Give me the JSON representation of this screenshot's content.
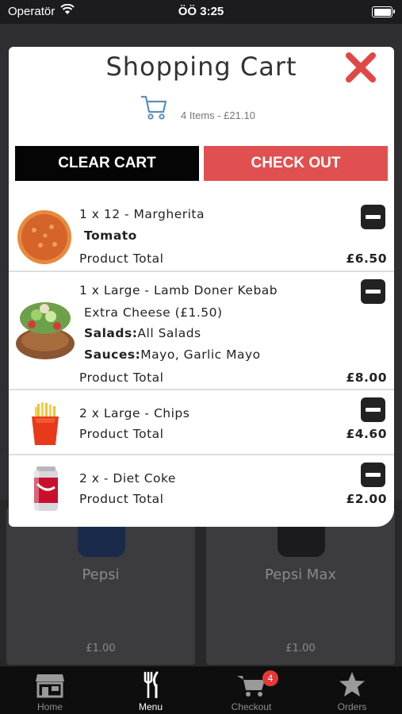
{
  "status_bar": {
    "carrier": "Operatör",
    "time": "ÖÖ 3:25"
  },
  "background_menu": {
    "products": [
      {
        "name": "Pepsi",
        "price": "£1.00"
      },
      {
        "name": "Pepsi Max",
        "price": "£1.00"
      }
    ]
  },
  "cart": {
    "title": "Shopping Cart",
    "summary": "4 Items - £21.10",
    "clear_label": "CLEAR CART",
    "checkout_label": "CHECK OUT",
    "total_label": "Product Total",
    "items": [
      {
        "name": "1 x 12 - Margherita",
        "options": [
          {
            "key": "",
            "value": "Tomato"
          }
        ],
        "total": "£6.50",
        "image": "pizza-image"
      },
      {
        "name": "1 x Large - Lamb Doner Kebab",
        "options": [
          {
            "key": "",
            "value": "Extra Cheese (£1.50)"
          },
          {
            "key": "Salads:",
            "value": "All Salads"
          },
          {
            "key": "Sauces:",
            "value": "Mayo, Garlic Mayo"
          }
        ],
        "total": "£8.00",
        "image": "kebab-image"
      },
      {
        "name": "2 x Large - Chips",
        "options": [],
        "total": "£4.60",
        "image": "chips-image"
      },
      {
        "name": "2 x - Diet Coke",
        "options": [],
        "total": "£2.00",
        "image": "diet-coke-image"
      }
    ]
  },
  "tab_bar": {
    "tabs": [
      {
        "label": "Home",
        "icon": "store-icon"
      },
      {
        "label": "Menu",
        "icon": "cutlery-icon"
      },
      {
        "label": "Checkout",
        "icon": "cart-icon"
      },
      {
        "label": "Orders",
        "icon": "star-icon"
      }
    ],
    "checkout_badge": "4"
  },
  "colors": {
    "checkout": "#e05050",
    "clear": "#050505",
    "close": "#e04848",
    "badge": "#e53935"
  }
}
